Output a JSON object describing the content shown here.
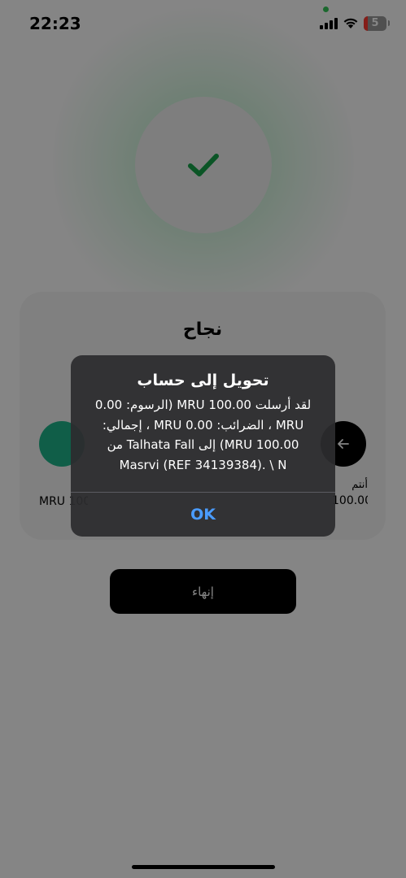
{
  "status_bar": {
    "time": "22:23",
    "battery_level": "5",
    "battery_color": "#ff3b30",
    "icons": [
      "signal-icon",
      "wifi-icon",
      "battery-icon"
    ]
  },
  "success": {
    "icon": "checkmark-icon",
    "icon_color": "#16a34a"
  },
  "card": {
    "title": "نجاح",
    "sender_label": "أنتم",
    "sender_amount": "100.00 MRU",
    "recipient_amount": "MRU 100.00",
    "left_avatar_color": "#1fb58a",
    "right_icon": "arrow-left-icon"
  },
  "finish_button": {
    "label": "إنهاء"
  },
  "alert": {
    "title": "تحويل إلى حساب",
    "message": "لقد أرسلت 100.00 MRU (الرسوم: 0.00 MRU ، الضرائب: 0.00 MRU ، إجمالي: 100.00 MRU) إلى Talhata Fall من Masrvi (REF 34139384). \\ N",
    "ok_label": "OK",
    "ok_color": "#4a9cff"
  }
}
